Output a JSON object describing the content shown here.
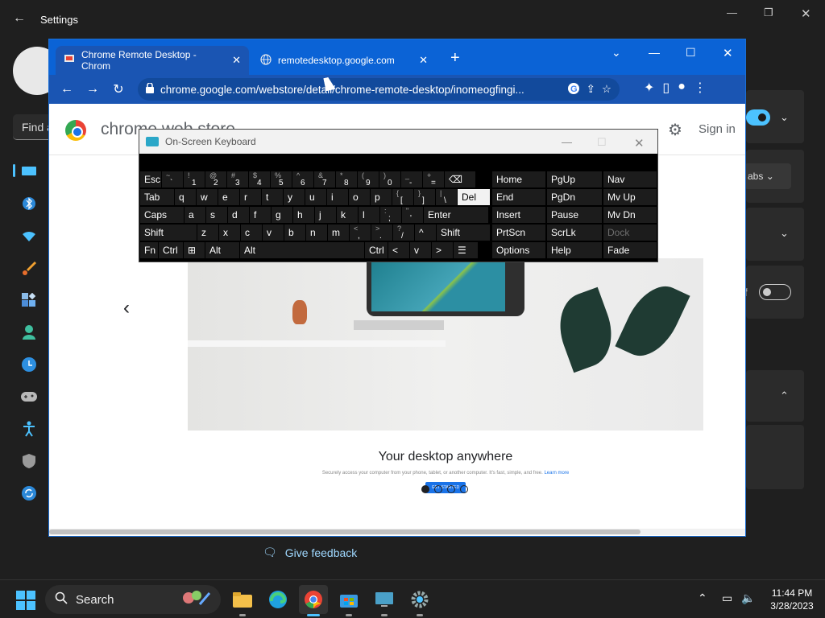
{
  "settings": {
    "title": "Settings",
    "find_prefix": "Find a",
    "tabs_pill": "abs",
    "toggle_off_label": "f",
    "feedback": "Give feedback",
    "colors": {
      "accent": "#4cc2ff",
      "bg": "#1f1f1f"
    },
    "nav_icons": [
      "system-icon",
      "bluetooth-icon",
      "network-icon",
      "personalization-icon",
      "apps-icon",
      "accounts-icon",
      "time-language-icon",
      "gaming-icon",
      "accessibility-icon",
      "privacy-shield-icon",
      "windows-update-icon"
    ]
  },
  "chrome": {
    "tabs": [
      {
        "label": "Chrome Remote Desktop - Chrom",
        "icon": "remote-desktop-icon"
      },
      {
        "label": "remotedesktop.google.com",
        "icon": "globe-icon"
      }
    ],
    "url": "chrome.google.com/webstore/detail/chrome-remote-desktop/inomeogfingi...",
    "colors": {
      "frame": "#0b63d6",
      "toolbar": "#1a55b3"
    }
  },
  "store": {
    "title": "chrome web store",
    "sign_in": "Sign in",
    "promo_heading": "Your desktop anywhere",
    "promo_text": "Securely access your computer from your phone, tablet, or another computer. It's fast, simple, and free.",
    "promo_link": "Learn more",
    "promo_cta": "GET STARTED",
    "carousel": {
      "count": 4,
      "active": 1
    }
  },
  "osk": {
    "title": "On-Screen Keyboard",
    "rows": [
      [
        "Esc",
        "~`",
        "!1",
        "@2",
        "#3",
        "$4",
        "%5",
        "^6",
        "&7",
        "*8",
        "(9",
        ")0",
        "_-",
        "+=",
        "⌫"
      ],
      [
        "Tab",
        "q",
        "w",
        "e",
        "r",
        "t",
        "y",
        "u",
        "i",
        "o",
        "p",
        "{[",
        "}]",
        "|\\",
        "Del"
      ],
      [
        "Caps",
        "a",
        "s",
        "d",
        "f",
        "g",
        "h",
        "j",
        "k",
        "l",
        ":;",
        "\"'",
        "Enter"
      ],
      [
        "Shift",
        "z",
        "x",
        "c",
        "v",
        "b",
        "n",
        "m",
        "<,",
        ">.",
        "?/",
        "^",
        "Shift"
      ],
      [
        "Fn",
        "Ctrl",
        "⊞",
        "Alt",
        "Alt",
        "Ctrl",
        "<",
        "v",
        ">",
        "☰"
      ]
    ],
    "side": [
      [
        "Home",
        "PgUp",
        "Nav"
      ],
      [
        "End",
        "PgDn",
        "Mv Up"
      ],
      [
        "Insert",
        "Pause",
        "Mv Dn"
      ],
      [
        "PrtScn",
        "ScrLk",
        "Dock"
      ],
      [
        "Options",
        "Help",
        "Fade"
      ]
    ],
    "highlighted_key": "Del",
    "disabled_key": "Dock"
  },
  "taskbar": {
    "search": "Search",
    "time": "11:44 PM",
    "date": "3/28/2023",
    "apps": [
      "widgets-icon",
      "file-explorer-icon",
      "edge-icon",
      "chrome-icon",
      "store-icon",
      "remote-desktop-icon",
      "settings-icon"
    ],
    "active_app": "chrome-icon"
  }
}
